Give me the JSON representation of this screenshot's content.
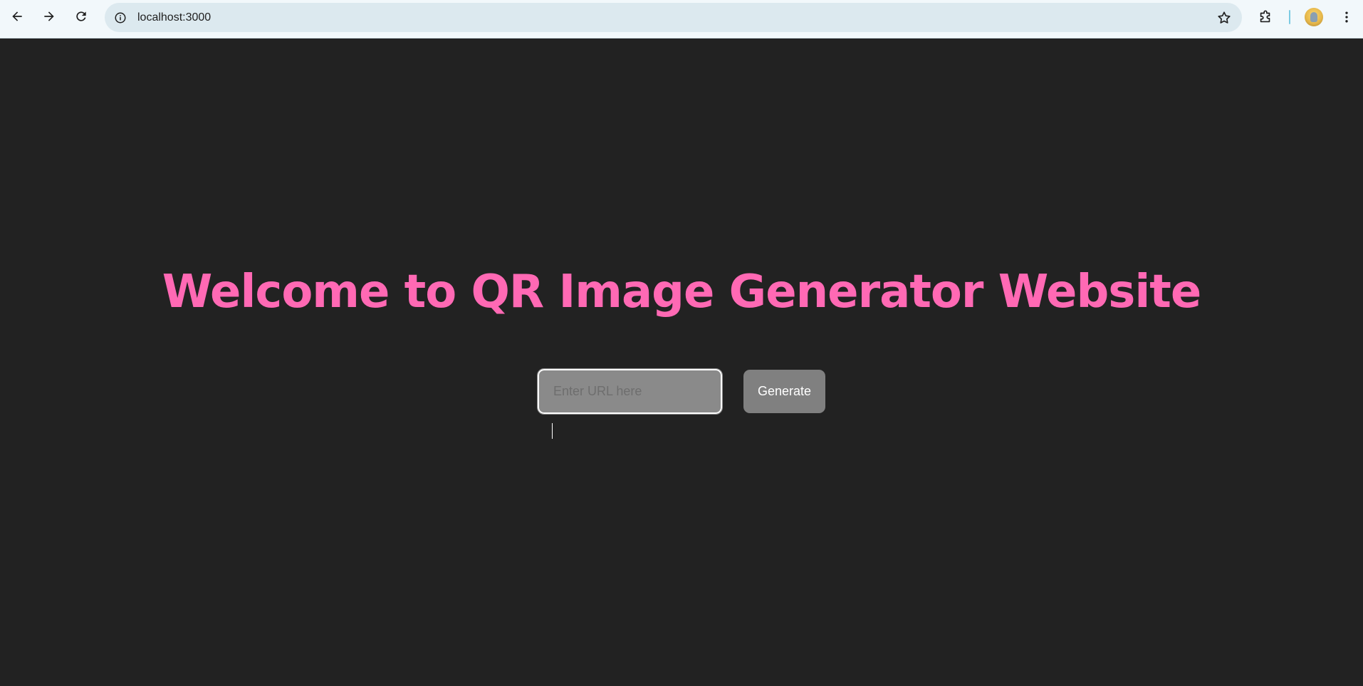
{
  "browser": {
    "url": "localhost:3000",
    "icons": {
      "back": "arrow-left-icon",
      "forward": "arrow-right-icon",
      "reload": "reload-icon",
      "site_info": "info-icon",
      "bookmark": "star-icon",
      "extensions": "puzzle-icon",
      "menu": "kebab-menu-icon"
    }
  },
  "page": {
    "heading": "Welcome to QR Image Generator Website",
    "input_placeholder": "Enter URL here",
    "generate_label": "Generate"
  },
  "colors": {
    "background": "#222222",
    "heading": "#ff69b4",
    "input_bg": "#8a8a8a",
    "button_bg": "#808080"
  }
}
